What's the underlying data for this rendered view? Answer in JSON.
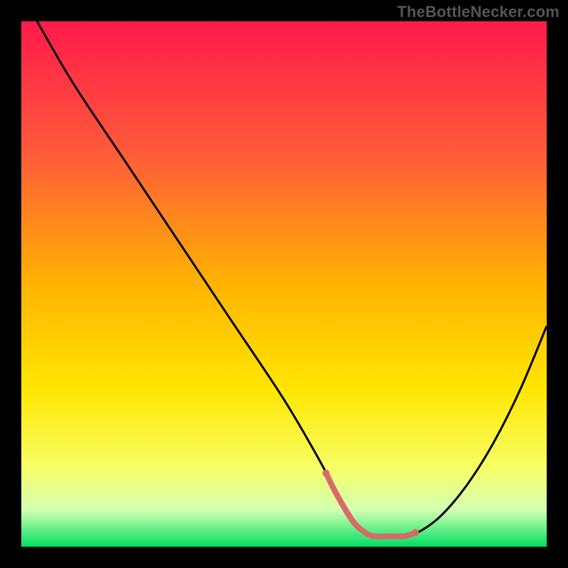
{
  "attribution": "TheBottleNecker.com",
  "chart_data": {
    "type": "line",
    "title": "",
    "xlabel": "",
    "ylabel": "",
    "xlim": [
      0,
      100
    ],
    "ylim": [
      0,
      100
    ],
    "series": [
      {
        "name": "curve",
        "x": [
          3,
          10,
          20,
          30,
          40,
          50,
          57,
          60,
          63,
          65,
          67,
          70,
          73,
          76,
          80,
          85,
          90,
          95,
          100
        ],
        "values": [
          100,
          88,
          73,
          58,
          43,
          28,
          16,
          10,
          5,
          3,
          2,
          2,
          2,
          3,
          6,
          12,
          20,
          30,
          42
        ]
      }
    ],
    "highlight_segment": {
      "x_start": 58,
      "x_end": 75
    },
    "background_gradient": {
      "stops": [
        {
          "offset": 0.0,
          "color": "#ff1a4b"
        },
        {
          "offset": 0.25,
          "color": "#ff5a3a"
        },
        {
          "offset": 0.5,
          "color": "#ffb300"
        },
        {
          "offset": 0.7,
          "color": "#ffe600"
        },
        {
          "offset": 0.85,
          "color": "#f7ff66"
        },
        {
          "offset": 0.93,
          "color": "#d4ffb3"
        },
        {
          "offset": 1.0,
          "color": "#00e060"
        }
      ]
    },
    "colors": {
      "curve": "#000000",
      "highlight": "#d86a6a"
    }
  }
}
